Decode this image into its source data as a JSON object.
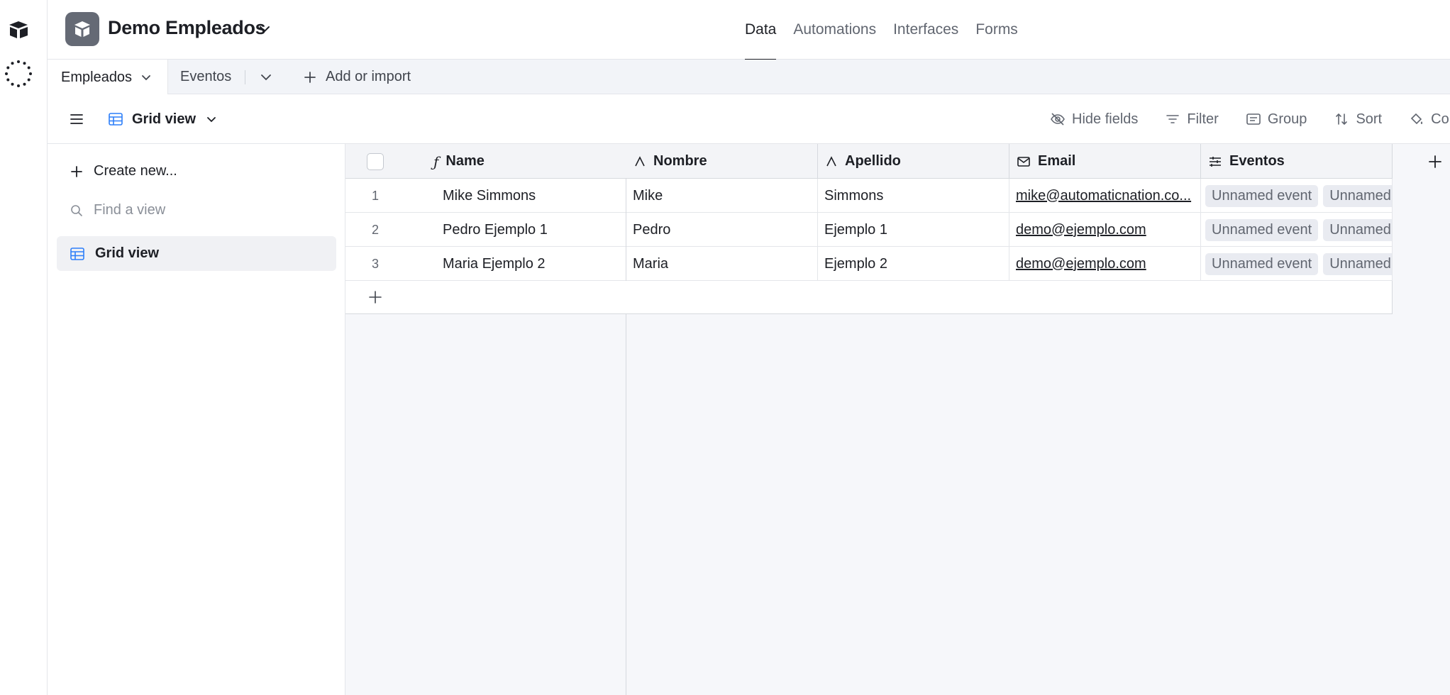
{
  "base": {
    "name": "Demo Empleados"
  },
  "nav": [
    "Data",
    "Automations",
    "Interfaces",
    "Forms"
  ],
  "tabs": {
    "active": "Empleados",
    "other": "Eventos",
    "add_label": "Add or import"
  },
  "view": {
    "name": "Grid view",
    "tools": [
      "Hide fields",
      "Filter",
      "Group",
      "Sort",
      "Colo"
    ]
  },
  "sidebar": {
    "create_label": "Create new...",
    "find_placeholder": "Find a view",
    "views": [
      "Grid view"
    ]
  },
  "table": {
    "columns": [
      "Name",
      "Nombre",
      "Apellido",
      "Email",
      "Eventos"
    ],
    "rows": [
      {
        "num": "1",
        "name": "Mike Simmons",
        "nombre": "Mike",
        "apellido": "Simmons",
        "email": "mike@automaticnation.co...",
        "eventos": [
          "Unnamed event",
          "Unnamed"
        ]
      },
      {
        "num": "2",
        "name": "Pedro Ejemplo 1",
        "nombre": "Pedro",
        "apellido": "Ejemplo 1",
        "email": "demo@ejemplo.com",
        "eventos": [
          "Unnamed event",
          "Unnamed"
        ]
      },
      {
        "num": "3",
        "name": "Maria Ejemplo 2",
        "nombre": "Maria",
        "apellido": "Ejemplo 2",
        "email": "demo@ejemplo.com",
        "eventos": [
          "Unnamed event",
          "Unnamed"
        ]
      }
    ]
  },
  "colors": {
    "accent": "#1d1f25",
    "chip_bg": "#e9ebf1",
    "view_icon": "#2d7ff9"
  }
}
